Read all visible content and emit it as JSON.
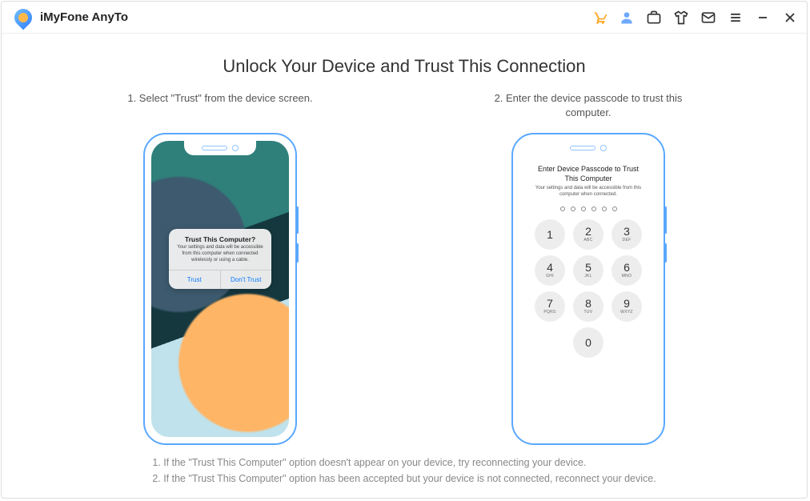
{
  "app": {
    "title": "iMyFone AnyTo"
  },
  "main": {
    "heading": "Unlock Your Device and Trust This Connection",
    "step1_label": "1. Select \"Trust\" from the device screen.",
    "step2_label": "2. Enter the device passcode to trust this computer.",
    "note1": "1. If the \"Trust This Computer\" option doesn't appear on your device, try reconnecting your device.",
    "note2": "2. If the \"Trust This Computer\" option has been accepted but your device is not connected, reconnect your device."
  },
  "phone1": {
    "dialog_title": "Trust This Computer?",
    "dialog_msg": "Your settings and data will be accessible from this computer when connected wirelessly or using a cable.",
    "trust_btn": "Trust",
    "dont_trust_btn": "Don't Trust"
  },
  "phone2": {
    "title": "Enter Device Passcode to Trust This Computer",
    "msg": "Your settings and data will be accessible from this computer when connected.",
    "keys": [
      {
        "n": "1",
        "l": ""
      },
      {
        "n": "2",
        "l": "ABC"
      },
      {
        "n": "3",
        "l": "DEF"
      },
      {
        "n": "4",
        "l": "GHI"
      },
      {
        "n": "5",
        "l": "JKL"
      },
      {
        "n": "6",
        "l": "MNO"
      },
      {
        "n": "7",
        "l": "PQRS"
      },
      {
        "n": "8",
        "l": "TUV"
      },
      {
        "n": "9",
        "l": "WXYZ"
      },
      {
        "n": "",
        "l": ""
      },
      {
        "n": "0",
        "l": ""
      },
      {
        "n": "",
        "l": ""
      }
    ]
  },
  "icons": {
    "cart": "cart-icon",
    "user": "user-icon",
    "briefcase": "briefcase-icon",
    "shirt": "shirt-icon",
    "mail": "mail-icon",
    "menu": "menu-icon",
    "minimize": "minimize-icon",
    "close": "close-icon"
  }
}
